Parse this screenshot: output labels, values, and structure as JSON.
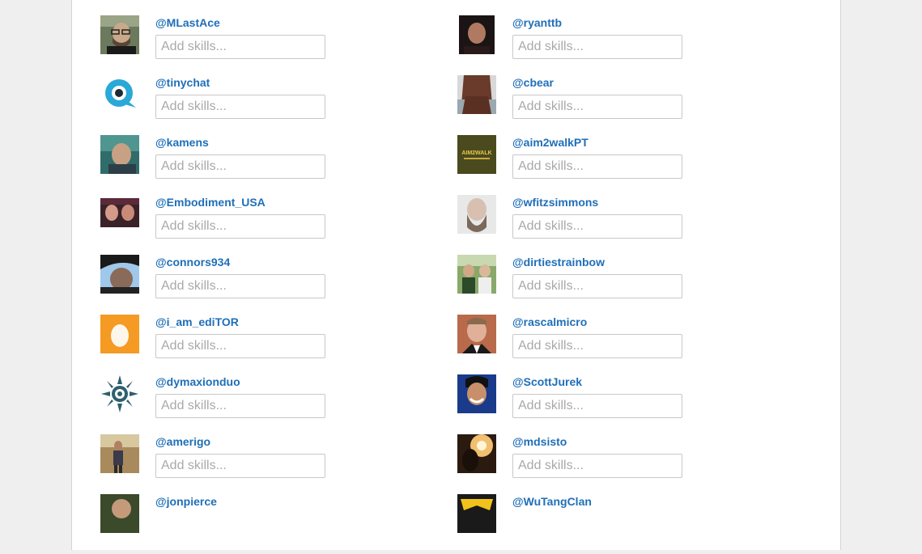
{
  "placeholder": "Add skills...",
  "left_column": [
    {
      "handle": "@MLastAce",
      "avatar": "man-glasses-photo"
    },
    {
      "handle": "@tinychat",
      "avatar": "tinychat-logo"
    },
    {
      "handle": "@kamens",
      "avatar": "man-outdoor-photo"
    },
    {
      "handle": "@Embodiment_USA",
      "avatar": "two-women-photo"
    },
    {
      "handle": "@connors934",
      "avatar": "man-cap-photo"
    },
    {
      "handle": "@i_am_ediTOR",
      "avatar": "default-egg-avatar"
    },
    {
      "handle": "@dymaxionduo",
      "avatar": "sun-emblem-logo"
    },
    {
      "handle": "@amerigo",
      "avatar": "man-standing-photo"
    },
    {
      "handle": "@jonpierce",
      "avatar": "person-photo"
    }
  ],
  "right_column": [
    {
      "handle": "@ryanttb",
      "avatar": "man-dark-photo"
    },
    {
      "handle": "@cbear",
      "avatar": "woman-hair-photo"
    },
    {
      "handle": "@aim2walkPT",
      "avatar": "aim2walk-logo"
    },
    {
      "handle": "@wfitzsimmons",
      "avatar": "bald-bearded-man-photo"
    },
    {
      "handle": "@dirtiestrainbow",
      "avatar": "two-people-photo"
    },
    {
      "handle": "@rascalmicro",
      "avatar": "man-suit-photo"
    },
    {
      "handle": "@ScottJurek",
      "avatar": "smiling-man-photo"
    },
    {
      "handle": "@mdsisto",
      "avatar": "sunset-silhouette-photo"
    },
    {
      "handle": "@WuTangClan",
      "avatar": "wu-tang-logo"
    }
  ],
  "avatar_logo_text": {
    "aim2walk": "AIM2WALK"
  },
  "colors": {
    "link": "#1f6fb8",
    "egg_bg": "#f59a23",
    "tinychat": "#2aa8d8",
    "sun_emblem": "#2e5f6e",
    "aim2walk_bg": "#4a4a1e",
    "wutang": "#f2c21a"
  }
}
